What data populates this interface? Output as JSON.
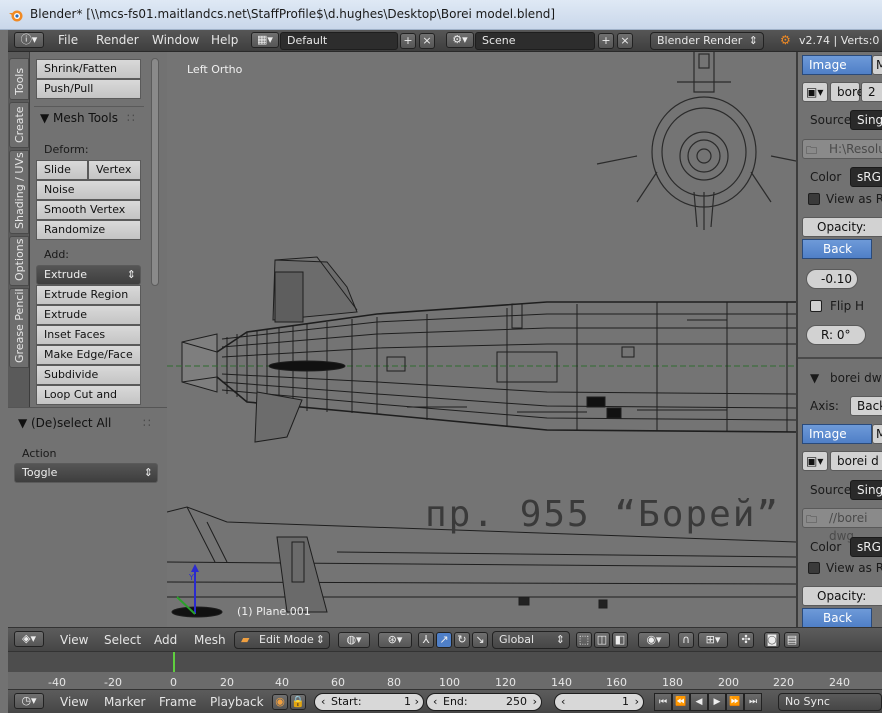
{
  "window": {
    "title": "Blender* [\\\\mcs-fs01.maitlandcs.net\\StaffProfile$\\d.hughes\\Desktop\\Borei model.blend]"
  },
  "info_header": {
    "menus": [
      "File",
      "Render",
      "Window",
      "Help"
    ],
    "screen_layout": "Default",
    "scene": "Scene",
    "render_engine": "Blender Render",
    "version_stats": "v2.74 | Verts:0"
  },
  "tool_tabs": [
    "Tools",
    "Create",
    "Shading / UVs",
    "Options",
    "Grease Pencil"
  ],
  "toolshelf": {
    "top_buttons": [
      "Shrink/Fatten",
      "Push/Pull"
    ],
    "mesh_tools_title": "Mesh Tools",
    "deform_label": "Deform:",
    "deform_row": [
      "Slide Ed",
      "Vertex"
    ],
    "deform_buttons": [
      "Noise",
      "Smooth Vertex",
      "Randomize"
    ],
    "add_label": "Add:",
    "extrude_dropdown": "Extrude",
    "add_buttons": [
      "Extrude Region",
      "Extrude Individual",
      "Inset Faces",
      "Make Edge/Face",
      "Subdivide",
      "Loop Cut and Slide"
    ]
  },
  "operator_panel": {
    "title": "(De)select All",
    "action_label": "Action",
    "action_value": "Toggle"
  },
  "viewport": {
    "view_name": "Left Ortho",
    "object_info": "(1) Plane.001",
    "drawing_caption": "пр. 955 “Борей”"
  },
  "properties": {
    "image_tab": "Image",
    "image_tab_2": "M",
    "image1_name": "bore",
    "image1_users": "2",
    "source_label": "Source",
    "source_value": "Singl",
    "path1": "H:\\Resoluti",
    "color_label": "Color",
    "color_value": "sRGB",
    "view_as_render": "View as Re",
    "opacity_label": "Opacity:",
    "back_label": "Back",
    "offset_x": "-0.10",
    "flip_h": "Flip H",
    "rotation": "R: 0°",
    "image2_panel": "borei dwg.j",
    "axis_label": "Axis:",
    "axis_value": "Back",
    "image2_name": "borei d",
    "path2": "//borei dwg",
    "source_value_2": "Singl",
    "color_value_2": "sRGB",
    "view_as_render_2": "View as Re",
    "opacity_label_2": "Opacity:",
    "back_label_2": "Back"
  },
  "view3d_header": {
    "menus": [
      "View",
      "Select",
      "Add",
      "Mesh"
    ],
    "mode": "Edit Mode",
    "orientation": "Global"
  },
  "timeline": {
    "ticks": [
      "-40",
      "-20",
      "0",
      "20",
      "40",
      "60",
      "80",
      "100",
      "120",
      "140",
      "160",
      "180",
      "200",
      "220",
      "240"
    ],
    "menus": [
      "View",
      "Marker",
      "Frame",
      "Playback"
    ],
    "start_label": "Start:",
    "start_value": "1",
    "end_label": "End:",
    "end_value": "250",
    "current_frame": "1",
    "sync": "No Sync"
  }
}
